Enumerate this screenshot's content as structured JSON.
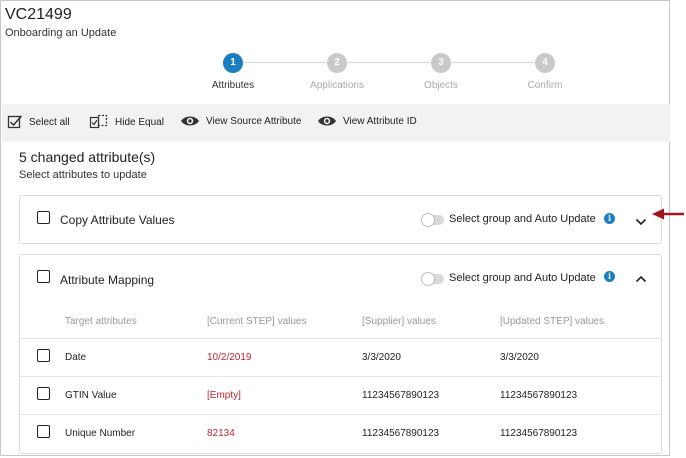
{
  "header": {
    "title": "VC21499",
    "subtitle": "Onboarding an Update"
  },
  "stepper": [
    {
      "number": "1",
      "label": "Attributes",
      "active": true
    },
    {
      "number": "2",
      "label": "Applications",
      "active": false
    },
    {
      "number": "3",
      "label": "Objects",
      "active": false
    },
    {
      "number": "4",
      "label": "Confirm",
      "active": false
    }
  ],
  "toolbar": {
    "select_all": "Select all",
    "hide_equal": "Hide Equal",
    "view_source": "View Source Attribute",
    "view_id": "View Attribute ID"
  },
  "summary": {
    "title": "5 changed attribute(s)",
    "subtitle": "Select attributes to update"
  },
  "groups": [
    {
      "title": "Copy Attribute Values",
      "auto_update_label": "Select group and Auto Update",
      "expanded": false
    },
    {
      "title": "Attribute Mapping",
      "auto_update_label": "Select group and Auto Update",
      "expanded": true,
      "columns": [
        "Target attributes",
        "[Current STEP] values",
        "[Supplier] values",
        "[Updated STEP] values"
      ],
      "rows": [
        {
          "target": "Date",
          "current": "10/2/2019",
          "supplier": "3/3/2020",
          "updated": "3/3/2020"
        },
        {
          "target": "GTIN Value",
          "current": "[Empty]",
          "supplier": "11234567890123",
          "updated": "11234567890123"
        },
        {
          "target": "Unique Number",
          "current": "82134",
          "supplier": "11234567890123",
          "updated": "11234567890123"
        }
      ]
    }
  ],
  "colors": {
    "accent": "#1a7fc1",
    "changed_value": "#c0272d",
    "annotation_arrow": "#a3151c"
  },
  "icons": {
    "select_all": "checkbox-checked-icon",
    "hide_equal": "compare-icon",
    "view": "eye-icon",
    "info": "info-icon",
    "collapse": "chevron-up-icon",
    "expand": "chevron-down-icon"
  }
}
